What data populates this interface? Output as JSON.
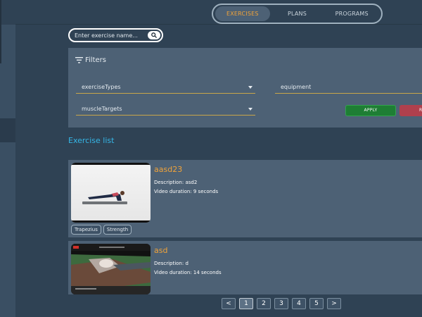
{
  "nav": {
    "tabs": [
      {
        "label": "EXERCISES",
        "active": true
      },
      {
        "label": "PLANS",
        "active": false
      },
      {
        "label": "PROGRAMS",
        "active": false
      }
    ]
  },
  "search": {
    "placeholder": "Enter exercise name...",
    "value": "",
    "icon": "search-icon"
  },
  "filters": {
    "title": "Filters",
    "icon": "filter-icon",
    "exercise_types": {
      "label": "exerciseTypes"
    },
    "equipment": {
      "label": "equipment"
    },
    "muscle_targets": {
      "label": "muscleTargets"
    },
    "apply_label": "APPLY",
    "reset_label": "R"
  },
  "exercise_list": {
    "title": "Exercise list",
    "items": [
      {
        "title": "aasd23",
        "description": "Description: asd2",
        "duration": "Video duration: 9 seconds",
        "tags": [
          "Trapezius",
          "Strength"
        ]
      },
      {
        "title": "asd",
        "description": "Description: d",
        "duration": "Video duration: 14 seconds",
        "tags": []
      }
    ]
  },
  "pagination": {
    "prev": "<",
    "pages": [
      "1",
      "2",
      "3",
      "4",
      "5"
    ],
    "current": "1",
    "next": ">"
  },
  "colors": {
    "background": "#2f4254",
    "panel": "#4d6175",
    "accent_orange": "#f0a33a",
    "accent_blue": "#35b6e6",
    "apply_green": "#1e7e34",
    "reset_red": "#b0404d"
  }
}
